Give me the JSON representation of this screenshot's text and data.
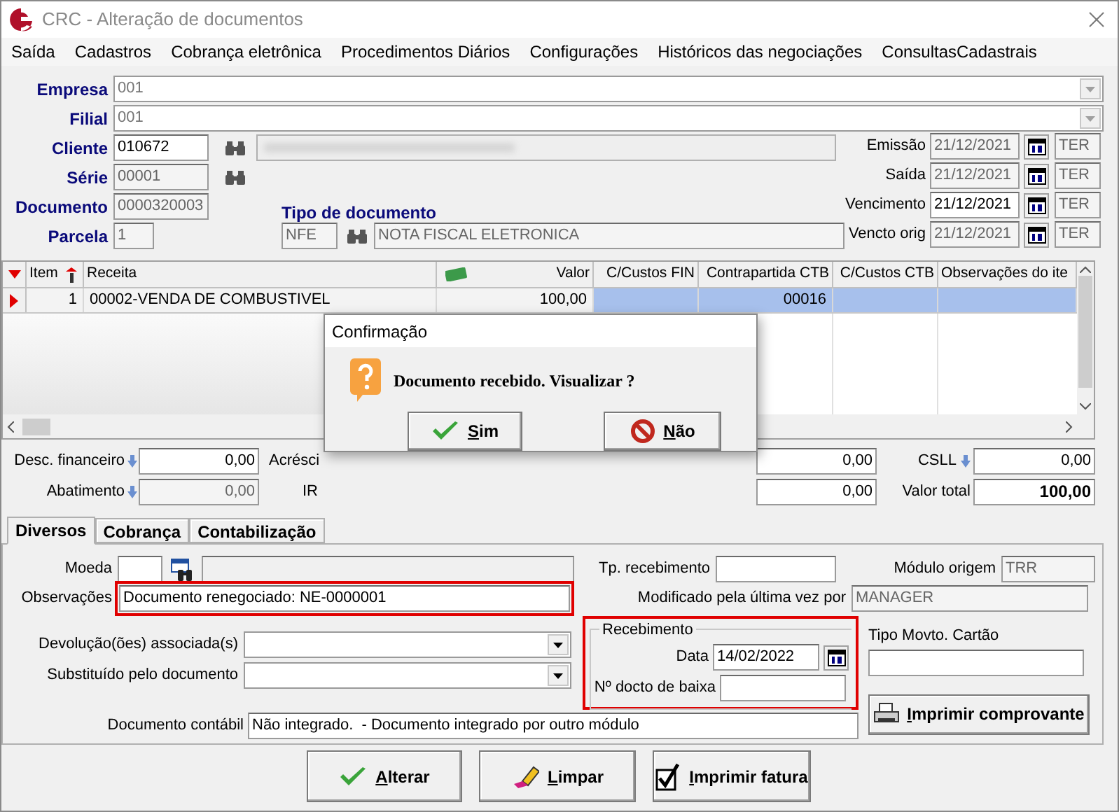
{
  "window": {
    "title": "CRC - Alteração de documentos"
  },
  "menu": [
    "Saída",
    "Cadastros",
    "Cobrança eletrônica",
    "Procedimentos Diários",
    "Configurações",
    "Históricos das negociações",
    "ConsultasCadastrais"
  ],
  "header": {
    "empresa": {
      "label": "Empresa",
      "value": "001"
    },
    "filial": {
      "label": "Filial",
      "value": "001"
    },
    "cliente": {
      "label": "Cliente",
      "value": "010672"
    },
    "serie": {
      "label": "Série",
      "value": "00001"
    },
    "documento": {
      "label": "Documento",
      "value": "0000320003"
    },
    "parcela": {
      "label": "Parcela",
      "value": "1"
    },
    "tipo_documento": {
      "label": "Tipo de documento",
      "code": "NFE",
      "description": "NOTA FISCAL ELETRONICA"
    },
    "dates": [
      {
        "label": "Emissão",
        "value": "21/12/2021",
        "day": "TER",
        "enabled": false
      },
      {
        "label": "Saída",
        "value": "21/12/2021",
        "day": "TER",
        "enabled": false
      },
      {
        "label": "Vencimento",
        "value": "21/12/2021",
        "day": "TER",
        "enabled": true
      },
      {
        "label": "Vencto orig",
        "value": "21/12/2021",
        "day": "TER",
        "enabled": false
      }
    ]
  },
  "grid": {
    "columns": [
      "Item",
      "Receita",
      "Valor",
      "C/Custos FIN",
      "Contrapartida CTB",
      "C/Custos CTB",
      "Observações do ite"
    ],
    "rows": [
      {
        "selected": true,
        "item": "1",
        "receita": "00002-VENDA DE COMBUSTIVEL",
        "valor": "100,00",
        "contrapartida_ctb": "00016"
      }
    ]
  },
  "totals": [
    {
      "label": "Desc. financeiro",
      "value": "0,00",
      "enabled": true,
      "second_label": "Acrésci",
      "middle_value": "0,00",
      "right": {
        "kind": "deduction",
        "label": "CSLL",
        "value": "0,00"
      }
    },
    {
      "label": "Abatimento",
      "value": "0,00",
      "enabled": false,
      "second_label": "IR",
      "middle_value": "0,00",
      "right": {
        "kind": "total",
        "label": "Valor total",
        "value": "100,00"
      }
    }
  ],
  "tabs": [
    {
      "label": "Diversos",
      "selected": true
    },
    {
      "label": "Cobrança",
      "selected": false
    },
    {
      "label": "Contabilização",
      "selected": false
    }
  ],
  "diversos": {
    "moeda": {
      "label": "Moeda"
    },
    "observacoes": {
      "label": "Observações",
      "value": "Documento renegociado: NE-0000001",
      "highlighted": true
    },
    "devolucoes": {
      "label": "Devolução(ões) associada(s)"
    },
    "substituido": {
      "label": "Substituído pelo documento"
    },
    "tp_recebimento": {
      "label": "Tp. recebimento"
    },
    "modulo_origem": {
      "label": "Módulo origem",
      "value": "TRR"
    },
    "modificado_por": {
      "label": "Modificado pela última vez por",
      "value": "MANAGER"
    },
    "recebimento": {
      "title": "Recebimento",
      "highlighted": true,
      "data_label": "Data",
      "data_value": "14/02/2022",
      "docto_label": "Nº docto de baixa"
    },
    "tipo_movto_cartao": {
      "label": "Tipo Movto. Cartão"
    },
    "documento_contabil": {
      "label": "Documento contábil",
      "value": "Não integrado.  - Documento integrado por outro módulo"
    },
    "imprimir_comprovante": "Imprimir comprovante"
  },
  "buttons": [
    "Alterar",
    "Limpar",
    "Imprimir fatura"
  ],
  "dialog": {
    "title": "Confirmação",
    "message": "Documento recebido. Visualizar ?",
    "buttons": [
      "Sim",
      "Não"
    ]
  }
}
